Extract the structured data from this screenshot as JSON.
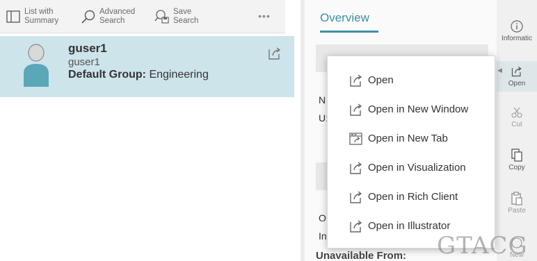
{
  "toolbar": {
    "list_label_1": "List with",
    "list_label_2": "Summary",
    "adv_label_1": "Advanced",
    "adv_label_2": "Search",
    "save_label_1": "Save",
    "save_label_2": "Search",
    "more": "•••"
  },
  "result": {
    "title": "guser1",
    "subtitle": "guser1",
    "group_key": "Default Group:",
    "group_value": "Engineering"
  },
  "overview": {
    "tab": "Overview",
    "frag_1": "N",
    "frag_2": "U:",
    "frag_3": "O",
    "frag_4": "In",
    "unavailable": "Unavailable From:"
  },
  "strip": {
    "information": "Informatic",
    "open": "Open",
    "cut": "Cut",
    "copy": "Copy",
    "paste": "Paste",
    "new": "New"
  },
  "menu": {
    "items": [
      {
        "label": "Open",
        "icon": "open-icon"
      },
      {
        "label": "Open in New Window",
        "icon": "open-window-icon"
      },
      {
        "label": "Open in New Tab",
        "icon": "new-tab-icon"
      },
      {
        "label": "Open in Visualization",
        "icon": "open-icon"
      },
      {
        "label": "Open in Rich Client",
        "icon": "open-icon"
      },
      {
        "label": "Open in Illustrator",
        "icon": "open-icon"
      }
    ]
  },
  "watermark": "GTACG",
  "colors": {
    "accent": "#3d8fa7",
    "selection": "#cde4ea",
    "avatar": "#5aa7b8"
  }
}
